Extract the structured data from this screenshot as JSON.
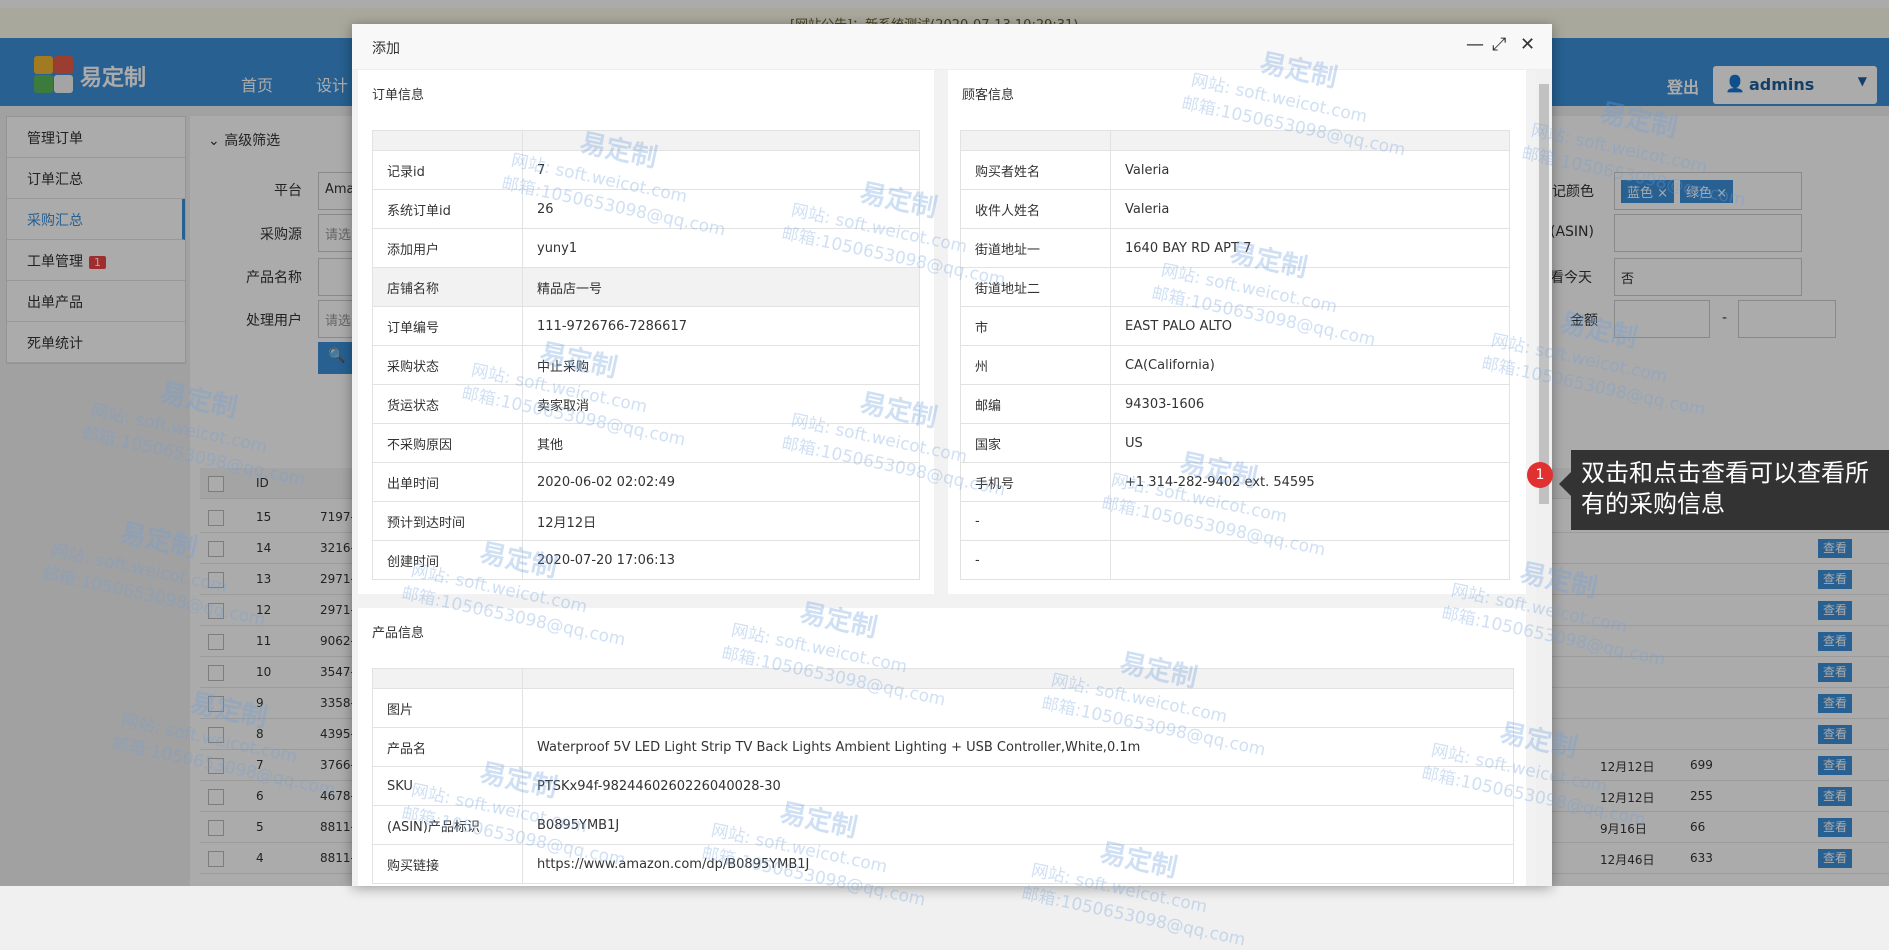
{
  "notice": "[网站公告]：新系统测试(2020-07-13 10:29:31)",
  "brand": "易定制",
  "nav": [
    "首页",
    "设计"
  ],
  "logout": "登出",
  "user": "admins",
  "sidebar": [
    {
      "label": "管理订单"
    },
    {
      "label": "订单汇总"
    },
    {
      "label": "采购汇总",
      "active": true
    },
    {
      "label": "工单管理",
      "badge": "1"
    },
    {
      "label": "出单产品"
    },
    {
      "label": "死单统计"
    }
  ],
  "filters": {
    "advanced": "高级筛选",
    "platform_label": "平台",
    "platform_value": "Ama",
    "source_label": "采购源",
    "source_placeholder": "请选",
    "product_label": "产品名称",
    "handler_label": "处理用户",
    "handler_placeholder": "请选",
    "color_label": "记颜色",
    "colors": [
      "蓝色",
      "绿色"
    ],
    "asin_label": "(ASIN)",
    "today_label": "看今天",
    "today_value": "否",
    "amount_label": "金额",
    "amount_sep": "-"
  },
  "table": {
    "header_id": "ID",
    "view_label": "查看",
    "rows": [
      {
        "id": "15",
        "code": "7197-"
      },
      {
        "id": "14",
        "code": "3216-"
      },
      {
        "id": "13",
        "code": "2971-"
      },
      {
        "id": "12",
        "code": "2971-"
      },
      {
        "id": "11",
        "code": "9062-"
      },
      {
        "id": "10",
        "code": "3547-"
      },
      {
        "id": "9",
        "code": "3358-"
      },
      {
        "id": "8",
        "code": "4395-"
      },
      {
        "id": "7",
        "code": "3766-",
        "date": "12月12日",
        "num": "699"
      },
      {
        "id": "6",
        "code": "4678-",
        "date": "12月12日",
        "num": "255"
      },
      {
        "id": "5",
        "code": "8811-",
        "date": "9月16日",
        "num": "66"
      },
      {
        "id": "4",
        "code": "8811-",
        "date": "12月46日",
        "num": "633"
      }
    ]
  },
  "modal": {
    "title": "添加",
    "order_section": "订单信息",
    "order_rows": [
      {
        "k": "记录id",
        "v": "7"
      },
      {
        "k": "系统订单id",
        "v": "26"
      },
      {
        "k": "添加用户",
        "v": "yuny1"
      },
      {
        "k": "店铺名称",
        "v": "精品店一号",
        "gray": true
      },
      {
        "k": "订单编号",
        "v": "111-9726766-7286617"
      },
      {
        "k": "采购状态",
        "v": "中止采购"
      },
      {
        "k": "货运状态",
        "v": "卖家取消"
      },
      {
        "k": "不采购原因",
        "v": "其他"
      },
      {
        "k": "出单时间",
        "v": "2020-06-02 02:02:49"
      },
      {
        "k": "预计到达时间",
        "v": "12月12日"
      },
      {
        "k": "创建时间",
        "v": "2020-07-20 17:06:13"
      }
    ],
    "customer_section": "顾客信息",
    "customer_rows": [
      {
        "k": "购买者姓名",
        "v": "Valeria"
      },
      {
        "k": "收件人姓名",
        "v": "Valeria"
      },
      {
        "k": "街道地址一",
        "v": "1640 BAY RD APT 7"
      },
      {
        "k": "街道地址二",
        "v": ""
      },
      {
        "k": "市",
        "v": "EAST PALO ALTO"
      },
      {
        "k": "州",
        "v": "CA(California)"
      },
      {
        "k": "邮编",
        "v": "94303-1606"
      },
      {
        "k": "国家",
        "v": "US"
      },
      {
        "k": "手机号",
        "v": "+1 314-282-9402 ext. 54595"
      },
      {
        "k": "-",
        "v": ""
      },
      {
        "k": "-",
        "v": ""
      }
    ],
    "product_section": "产品信息",
    "product_rows": [
      {
        "k": "图片",
        "v": ""
      },
      {
        "k": "产品名",
        "v": "Waterproof 5V LED Light Strip TV Back Lights Ambient Lighting + USB Controller,White,0.1m"
      },
      {
        "k": "SKU",
        "v": "PTSKx94f-9824460260226040028-30"
      },
      {
        "k": "(ASIN)产品标识",
        "v": "B0895YMB1J"
      },
      {
        "k": "购买链接",
        "v": "https://www.amazon.com/dp/B0895YMB1J"
      }
    ]
  },
  "tooltip": {
    "num": "1",
    "text": "双击和点击查看可以查看所有的采购信息"
  },
  "watermark": {
    "brand": "易定制",
    "site": "网站: soft.weicot.com",
    "mail": "邮箱:1050653098@qq.com"
  }
}
